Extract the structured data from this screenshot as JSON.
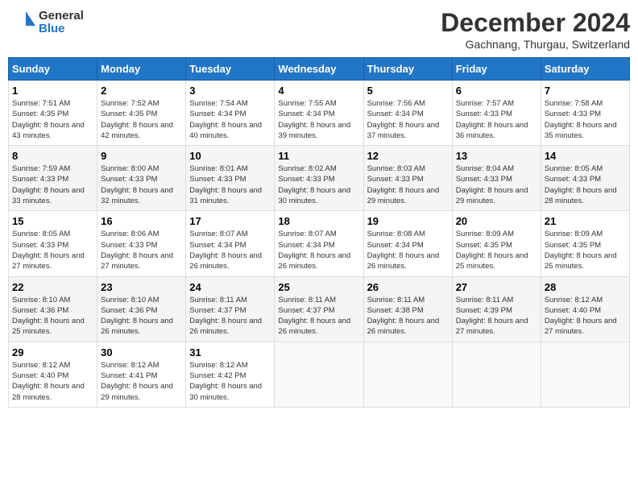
{
  "header": {
    "logo_line1": "General",
    "logo_line2": "Blue",
    "month": "December 2024",
    "location": "Gachnang, Thurgau, Switzerland"
  },
  "weekdays": [
    "Sunday",
    "Monday",
    "Tuesday",
    "Wednesday",
    "Thursday",
    "Friday",
    "Saturday"
  ],
  "weeks": [
    [
      {
        "day": "1",
        "sunrise": "7:51 AM",
        "sunset": "4:35 PM",
        "daylight": "8 hours and 43 minutes."
      },
      {
        "day": "2",
        "sunrise": "7:52 AM",
        "sunset": "4:35 PM",
        "daylight": "8 hours and 42 minutes."
      },
      {
        "day": "3",
        "sunrise": "7:54 AM",
        "sunset": "4:34 PM",
        "daylight": "8 hours and 40 minutes."
      },
      {
        "day": "4",
        "sunrise": "7:55 AM",
        "sunset": "4:34 PM",
        "daylight": "8 hours and 39 minutes."
      },
      {
        "day": "5",
        "sunrise": "7:56 AM",
        "sunset": "4:34 PM",
        "daylight": "8 hours and 37 minutes."
      },
      {
        "day": "6",
        "sunrise": "7:57 AM",
        "sunset": "4:33 PM",
        "daylight": "8 hours and 36 minutes."
      },
      {
        "day": "7",
        "sunrise": "7:58 AM",
        "sunset": "4:33 PM",
        "daylight": "8 hours and 35 minutes."
      }
    ],
    [
      {
        "day": "8",
        "sunrise": "7:59 AM",
        "sunset": "4:33 PM",
        "daylight": "8 hours and 33 minutes."
      },
      {
        "day": "9",
        "sunrise": "8:00 AM",
        "sunset": "4:33 PM",
        "daylight": "8 hours and 32 minutes."
      },
      {
        "day": "10",
        "sunrise": "8:01 AM",
        "sunset": "4:33 PM",
        "daylight": "8 hours and 31 minutes."
      },
      {
        "day": "11",
        "sunrise": "8:02 AM",
        "sunset": "4:33 PM",
        "daylight": "8 hours and 30 minutes."
      },
      {
        "day": "12",
        "sunrise": "8:03 AM",
        "sunset": "4:33 PM",
        "daylight": "8 hours and 29 minutes."
      },
      {
        "day": "13",
        "sunrise": "8:04 AM",
        "sunset": "4:33 PM",
        "daylight": "8 hours and 29 minutes."
      },
      {
        "day": "14",
        "sunrise": "8:05 AM",
        "sunset": "4:33 PM",
        "daylight": "8 hours and 28 minutes."
      }
    ],
    [
      {
        "day": "15",
        "sunrise": "8:05 AM",
        "sunset": "4:33 PM",
        "daylight": "8 hours and 27 minutes."
      },
      {
        "day": "16",
        "sunrise": "8:06 AM",
        "sunset": "4:33 PM",
        "daylight": "8 hours and 27 minutes."
      },
      {
        "day": "17",
        "sunrise": "8:07 AM",
        "sunset": "4:34 PM",
        "daylight": "8 hours and 26 minutes."
      },
      {
        "day": "18",
        "sunrise": "8:07 AM",
        "sunset": "4:34 PM",
        "daylight": "8 hours and 26 minutes."
      },
      {
        "day": "19",
        "sunrise": "8:08 AM",
        "sunset": "4:34 PM",
        "daylight": "8 hours and 26 minutes."
      },
      {
        "day": "20",
        "sunrise": "8:09 AM",
        "sunset": "4:35 PM",
        "daylight": "8 hours and 25 minutes."
      },
      {
        "day": "21",
        "sunrise": "8:09 AM",
        "sunset": "4:35 PM",
        "daylight": "8 hours and 25 minutes."
      }
    ],
    [
      {
        "day": "22",
        "sunrise": "8:10 AM",
        "sunset": "4:36 PM",
        "daylight": "8 hours and 25 minutes."
      },
      {
        "day": "23",
        "sunrise": "8:10 AM",
        "sunset": "4:36 PM",
        "daylight": "8 hours and 26 minutes."
      },
      {
        "day": "24",
        "sunrise": "8:11 AM",
        "sunset": "4:37 PM",
        "daylight": "8 hours and 26 minutes."
      },
      {
        "day": "25",
        "sunrise": "8:11 AM",
        "sunset": "4:37 PM",
        "daylight": "8 hours and 26 minutes."
      },
      {
        "day": "26",
        "sunrise": "8:11 AM",
        "sunset": "4:38 PM",
        "daylight": "8 hours and 26 minutes."
      },
      {
        "day": "27",
        "sunrise": "8:11 AM",
        "sunset": "4:39 PM",
        "daylight": "8 hours and 27 minutes."
      },
      {
        "day": "28",
        "sunrise": "8:12 AM",
        "sunset": "4:40 PM",
        "daylight": "8 hours and 27 minutes."
      }
    ],
    [
      {
        "day": "29",
        "sunrise": "8:12 AM",
        "sunset": "4:40 PM",
        "daylight": "8 hours and 28 minutes."
      },
      {
        "day": "30",
        "sunrise": "8:12 AM",
        "sunset": "4:41 PM",
        "daylight": "8 hours and 29 minutes."
      },
      {
        "day": "31",
        "sunrise": "8:12 AM",
        "sunset": "4:42 PM",
        "daylight": "8 hours and 30 minutes."
      },
      null,
      null,
      null,
      null
    ]
  ],
  "labels": {
    "sunrise": "Sunrise:",
    "sunset": "Sunset:",
    "daylight": "Daylight:"
  }
}
